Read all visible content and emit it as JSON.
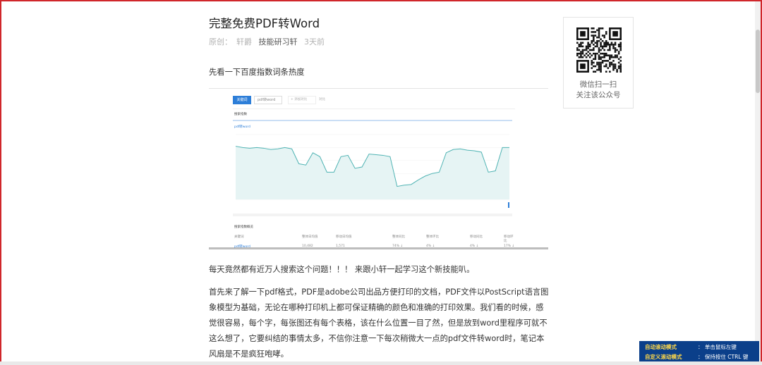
{
  "article": {
    "title": "完整免费PDF转Word",
    "meta": {
      "original": "原创：",
      "author": "轩爵",
      "account": "技能研习轩",
      "time": "3天前"
    },
    "para1": "先看一下百度指数词条热度",
    "para2": "每天竟然都有近万人搜索这个问题！！！ 来跟小轩一起学习这个新技能叭。",
    "para3": "首先来了解一下pdf格式，PDF是adobe公司出品方便打印的文档，PDF文件以PostScript语言图象模型为基础，无论在哪种打印机上都可保证精确的颜色和准确的打印效果。我们看的时候，感觉很容易，每个字，每张图还有每个表格，该在什么位置一目了然，但是放到word里程序可就不这么想了，它要纠结的事情太多，不信你注意一下每次稍微大一点的pdf文件转word时，笔记本风扇是不是疯狂咆哮。"
  },
  "screenshot": {
    "tab_label": "关键词",
    "search_term": "pdf转word",
    "add_compare": "+ 添加对比",
    "compare": "对比",
    "trend_title": "搜索指数",
    "legend": "pdf转word",
    "overview_title": "搜索指数概览",
    "table_headers": [
      "关键词",
      "整体日均值",
      "移动日均值",
      "整体同比",
      "整体环比",
      "移动同比",
      "移动环比"
    ],
    "table_row": [
      "pdf转word",
      "10,482",
      "1,571",
      "74% ↓",
      "4% ↓",
      "4% ↓",
      "17% ↓"
    ]
  },
  "chart_data": {
    "type": "line",
    "series": [
      {
        "values": [
          0.82,
          0.8,
          0.79,
          0.8,
          0.79,
          0.77,
          0.78,
          0.8,
          0.78,
          0.55,
          0.53,
          0.72,
          0.66,
          0.42,
          0.42,
          0.66,
          0.68,
          0.48,
          0.5,
          0.7,
          0.69,
          0.68,
          0.66,
          0.2,
          0.22,
          0.23,
          0.3,
          0.36,
          0.4,
          0.42,
          0.72,
          0.77,
          0.78,
          0.76,
          0.75,
          0.73,
          0.42,
          0.44,
          0.8,
          0.8
        ]
      }
    ]
  },
  "qr": {
    "line1": "微信扫一扫",
    "line2": "关注该公众号"
  },
  "helper": {
    "row1_key": "自动滚动模式",
    "row1_val": "：  单击鼠标左键",
    "row2_key": "自定义滚动模式",
    "row2_val": "：  保持按住 CTRL 键"
  },
  "colors": {
    "frame": "#d0262b",
    "helper_bg": "#0b3f8a",
    "line": "#4fb3b3",
    "accent": "#2d7ed8"
  }
}
